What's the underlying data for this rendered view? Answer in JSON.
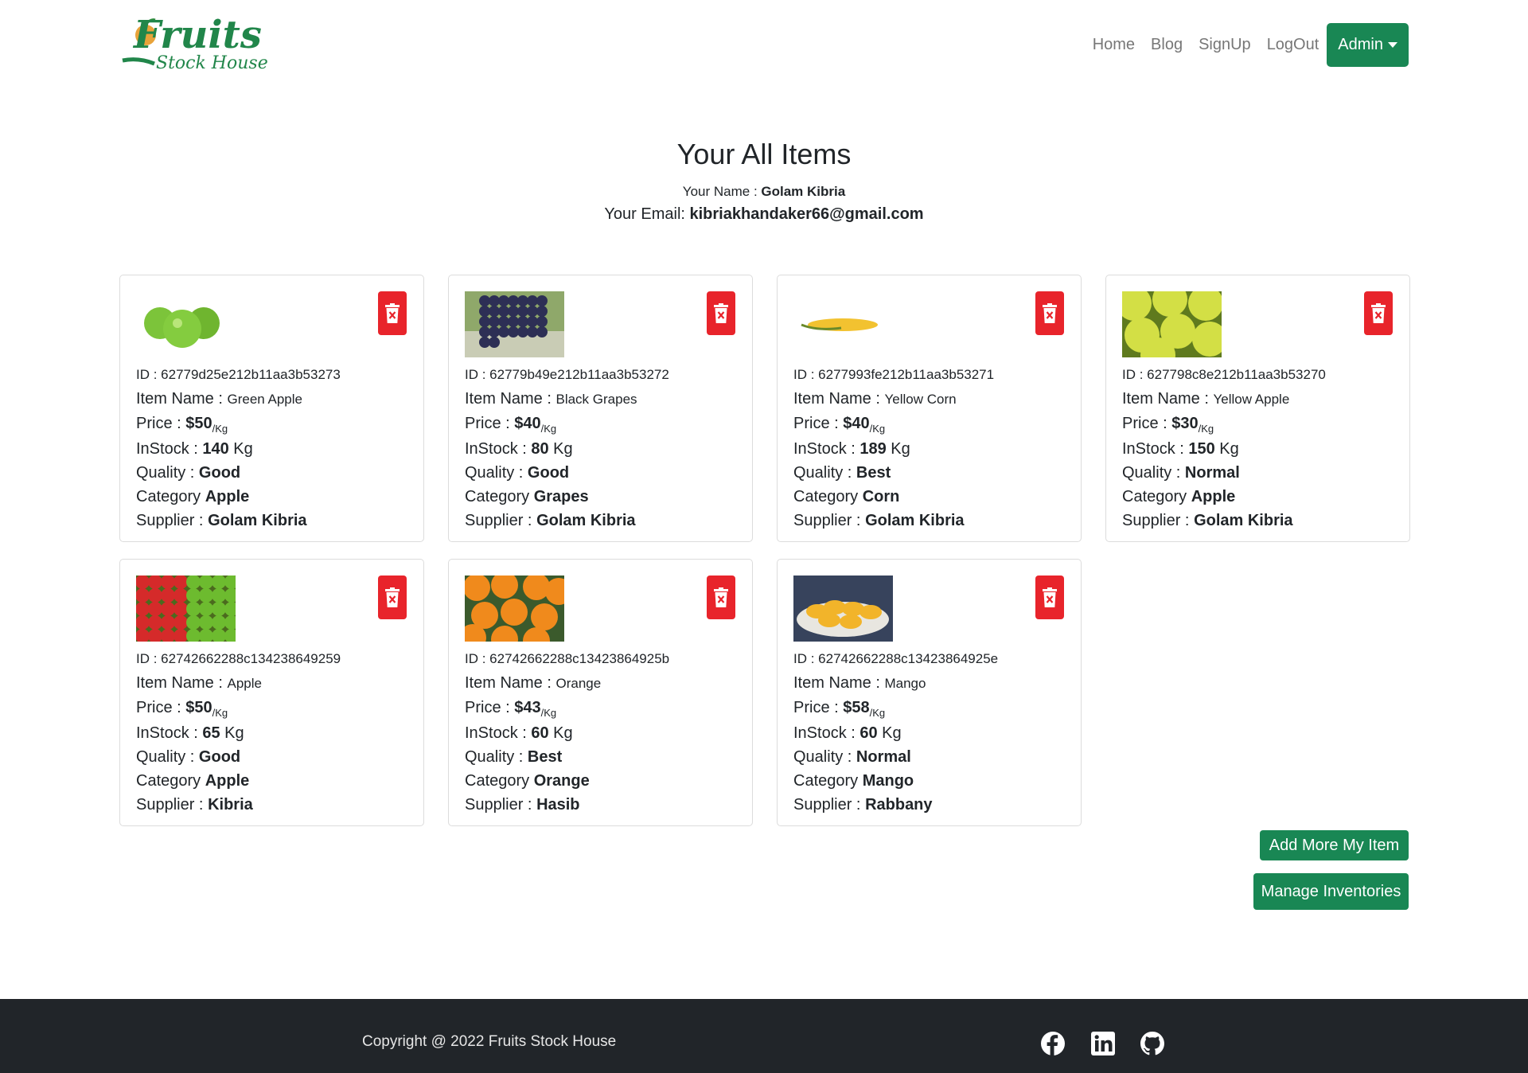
{
  "logo": {
    "main": "Fruits",
    "sub": "Stock House"
  },
  "nav": {
    "links": [
      "Home",
      "Blog",
      "SignUp",
      "LogOut"
    ],
    "admin_label": "Admin"
  },
  "header": {
    "title": "Your All Items",
    "name_label": "Your Name : ",
    "name_value": "Golam Kibria",
    "email_label": "Your Email: ",
    "email_value": "kibriakhandaker66@gmail.com"
  },
  "labels": {
    "id": "ID : ",
    "item_name": "Item Name : ",
    "price": "Price : ",
    "price_unit": "/Kg",
    "instock": "InStock : ",
    "instock_unit": " Kg",
    "quality": "Quality : ",
    "category": "Category ",
    "supplier": "Supplier : "
  },
  "items": [
    {
      "id": "62779d25e212b11aa3b53273",
      "name": "Green Apple",
      "price": "$50",
      "instock": "140",
      "quality": "Good",
      "category": "Apple",
      "supplier": "Golam Kibria",
      "image": "green-apple"
    },
    {
      "id": "62779b49e212b11aa3b53272",
      "name": "Black Grapes",
      "price": "$40",
      "instock": "80",
      "quality": "Good",
      "category": "Grapes",
      "supplier": "Golam Kibria",
      "image": "black-grapes"
    },
    {
      "id": "6277993fe212b11aa3b53271",
      "name": "Yellow Corn",
      "price": "$40",
      "instock": "189",
      "quality": "Best",
      "category": "Corn",
      "supplier": "Golam Kibria",
      "image": "yellow-corn"
    },
    {
      "id": "627798c8e212b11aa3b53270",
      "name": "Yellow Apple",
      "price": "$30",
      "instock": "150",
      "quality": "Normal",
      "category": "Apple",
      "supplier": "Golam Kibria",
      "image": "yellow-apple"
    },
    {
      "id": "62742662288c134238649259",
      "name": "Apple",
      "price": "$50",
      "instock": "65",
      "quality": "Good",
      "category": "Apple",
      "supplier": "Kibria",
      "image": "mixed-apples"
    },
    {
      "id": "62742662288c13423864925b",
      "name": "Orange",
      "price": "$43",
      "instock": "60",
      "quality": "Best",
      "category": "Orange",
      "supplier": "Hasib",
      "image": "oranges"
    },
    {
      "id": "62742662288c13423864925e",
      "name": "Mango",
      "price": "$58",
      "instock": "60",
      "quality": "Normal",
      "category": "Mango",
      "supplier": "Rabbany",
      "image": "mangoes"
    }
  ],
  "buttons": {
    "add": "Add More My Item",
    "manage": "Manage Inventories"
  },
  "footer": {
    "copyright": "Copyright @ 2022 Fruits Stock House",
    "social": [
      "facebook-icon",
      "linkedin-icon",
      "github-icon"
    ]
  },
  "colors": {
    "brand_green": "#198754",
    "delete_red": "#e8242b",
    "footer_bg": "#212529"
  }
}
